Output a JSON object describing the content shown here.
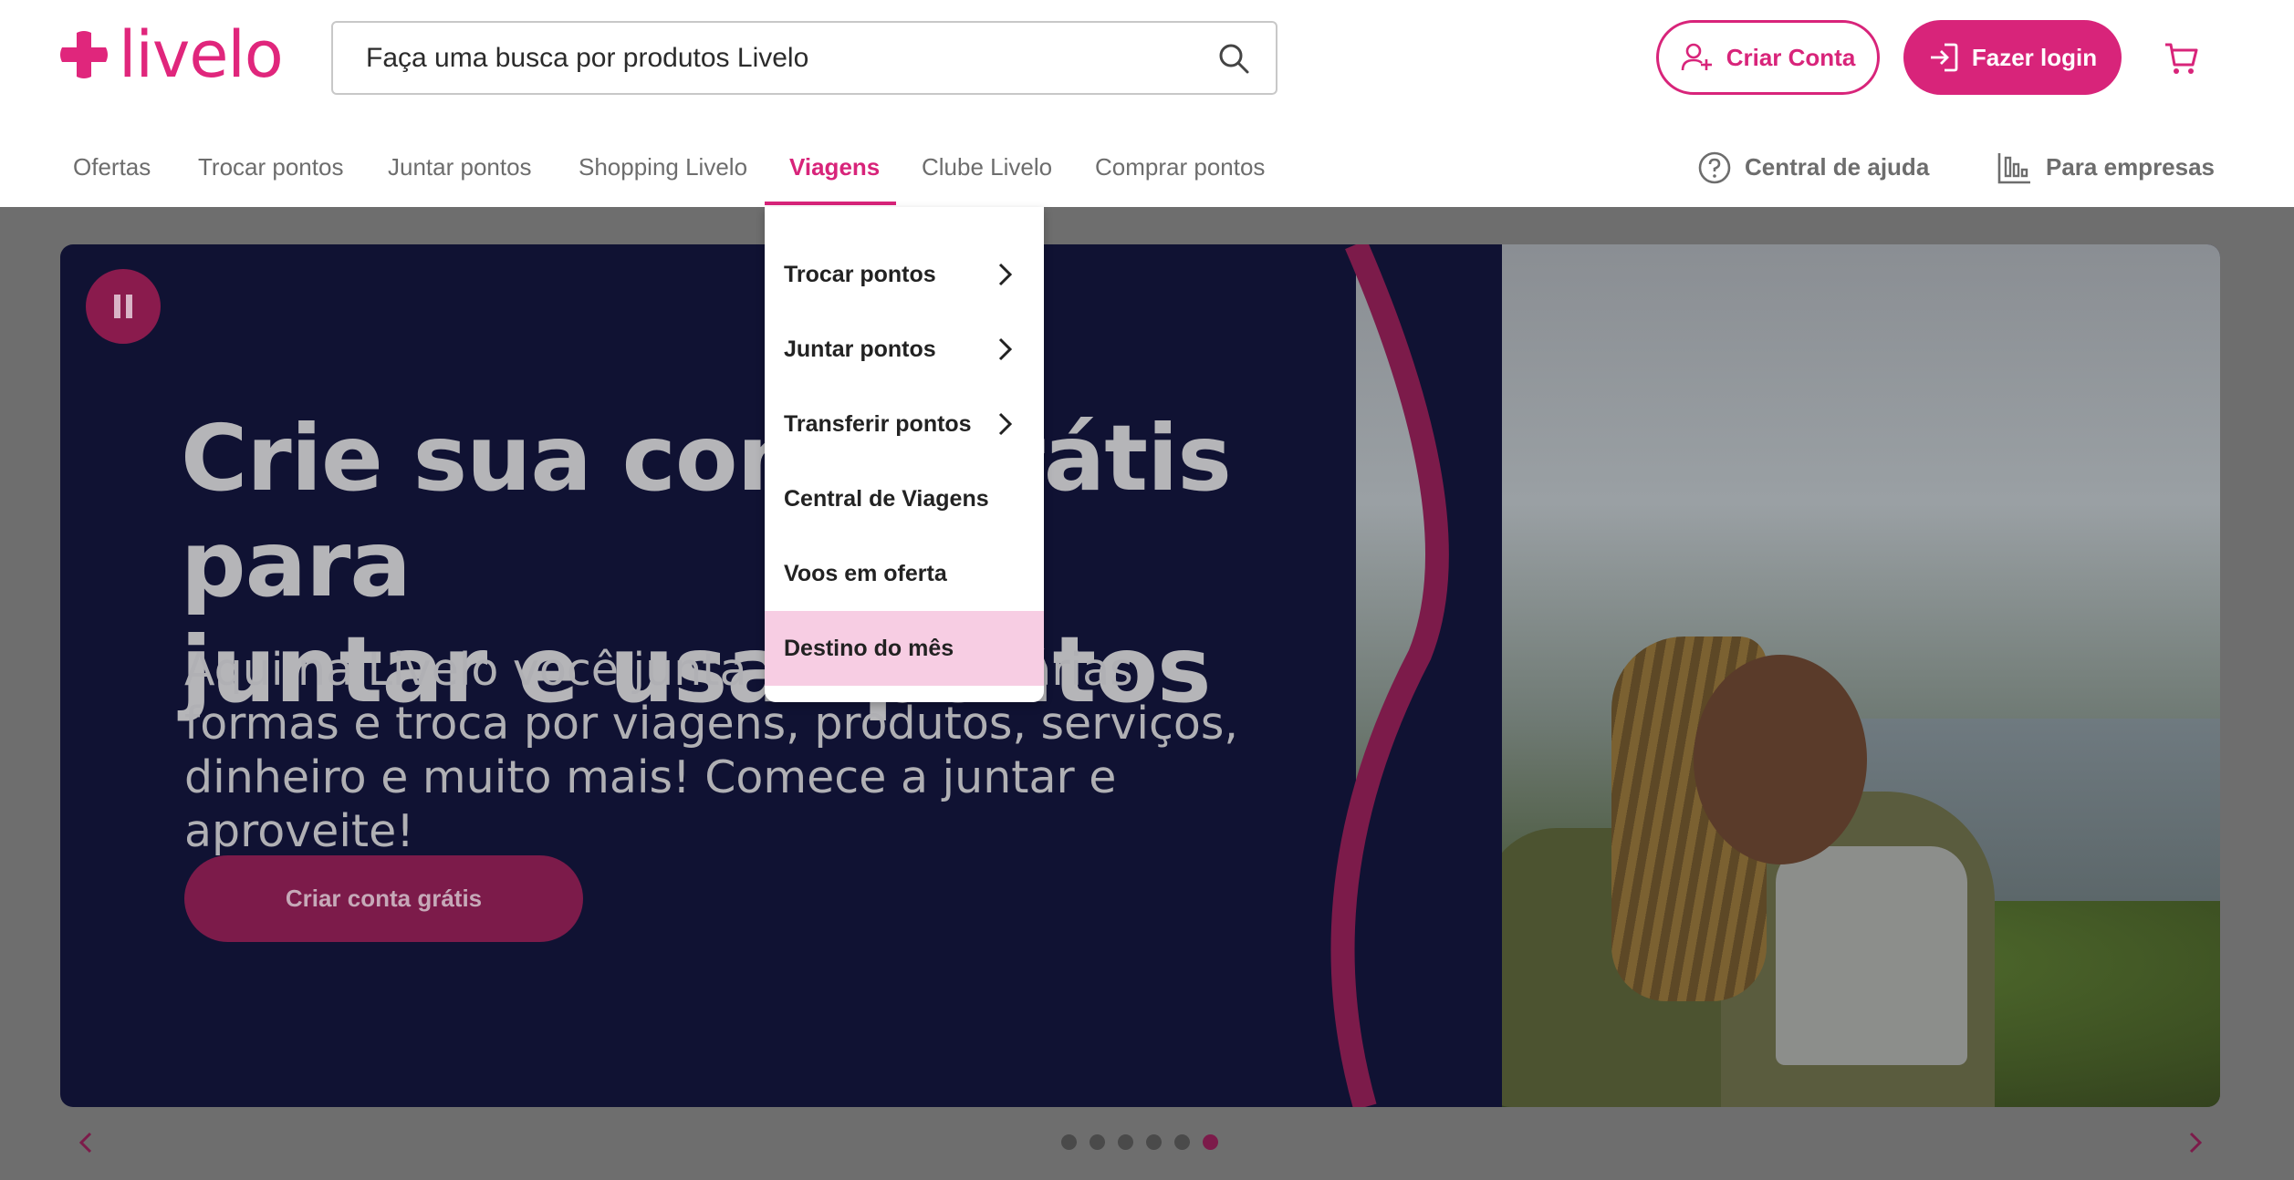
{
  "brand": {
    "name": "livelo",
    "accent": "#d8247a"
  },
  "search": {
    "placeholder": "Faça uma busca por produtos Livelo",
    "icon": "search-icon"
  },
  "header": {
    "create_account": "Criar Conta",
    "login": "Fazer login",
    "cart_icon": "cart-icon"
  },
  "nav": {
    "items": [
      {
        "label": "Ofertas"
      },
      {
        "label": "Trocar pontos"
      },
      {
        "label": "Juntar pontos"
      },
      {
        "label": "Shopping Livelo"
      },
      {
        "label": "Viagens",
        "active": true
      },
      {
        "label": "Clube Livelo"
      },
      {
        "label": "Comprar pontos"
      }
    ],
    "help": "Central de ajuda",
    "business": "Para empresas"
  },
  "dropdown": {
    "items": [
      {
        "label": "Trocar pontos",
        "has_submenu": true
      },
      {
        "label": "Juntar pontos",
        "has_submenu": true
      },
      {
        "label": "Transferir pontos",
        "has_submenu": true
      },
      {
        "label": "Central de Viagens",
        "has_submenu": false
      },
      {
        "label": "Voos em oferta",
        "has_submenu": false
      },
      {
        "label": "Destino do mês",
        "has_submenu": false,
        "highlighted": true
      }
    ]
  },
  "hero": {
    "title_line1": "Crie sua conta grátis para",
    "title_line2": "juntar e usar pontos",
    "subtitle": "Aqui na Livelo você junta pontos de várias formas e troca por viagens, produtos, serviços, dinheiro e muito mais! Comece a juntar e aproveite!",
    "cta": "Criar conta grátis"
  },
  "carousel": {
    "slides": 6,
    "active_index": 5
  }
}
